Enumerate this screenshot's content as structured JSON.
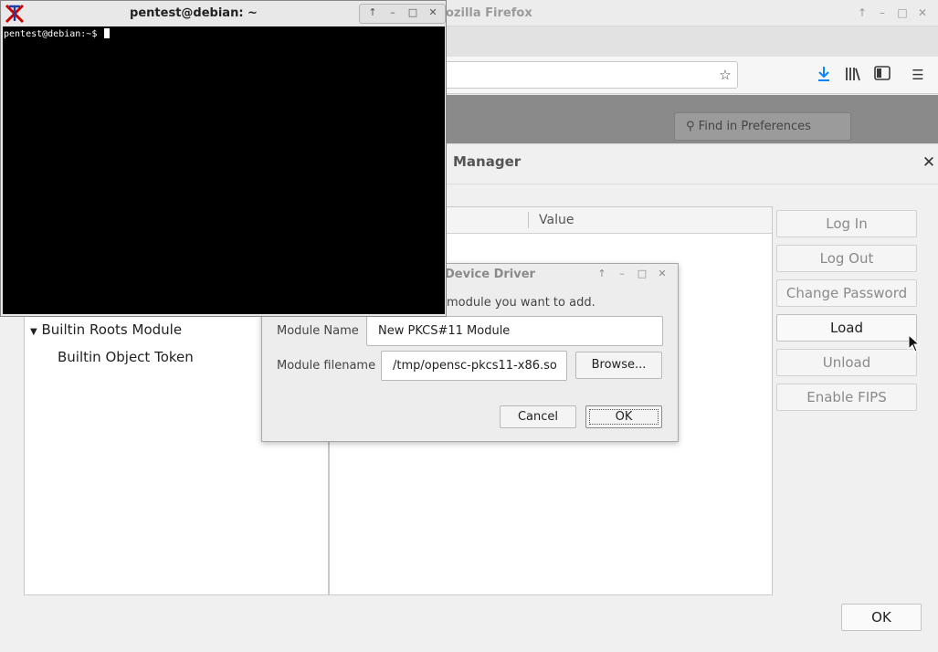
{
  "firefox": {
    "title_visible": "ozilla Firefox",
    "find_placeholder": "Find in Preferences",
    "toolbar_icons": [
      "bookmark-star-icon",
      "downloads-icon",
      "library-icon",
      "sidebar-icon",
      "menu-icon"
    ]
  },
  "device_manager": {
    "title_visible": "Manager",
    "column_value": "Value",
    "tree": {
      "module": "Builtin Roots Module",
      "token": "Builtin Object Token"
    },
    "buttons": {
      "login": "Log In",
      "logout": "Log Out",
      "change_password": "Change Password",
      "load": "Load",
      "unload": "Unload",
      "enable_fips": "Enable FIPS"
    },
    "ok": "OK"
  },
  "load_dialog": {
    "title_visible": "Device Driver",
    "prompt_visible": "module you want to add.",
    "module_name_label": "Module Name",
    "module_name_value": "New PKCS#11 Module",
    "module_file_label": "Module filename",
    "module_file_value": "/tmp/opensc-pkcs11-x86.so",
    "browse": "Browse...",
    "cancel": "Cancel",
    "ok": "OK"
  },
  "xterm": {
    "title": "pentest@debian: ~",
    "prompt": "pentest@debian:~$ "
  }
}
